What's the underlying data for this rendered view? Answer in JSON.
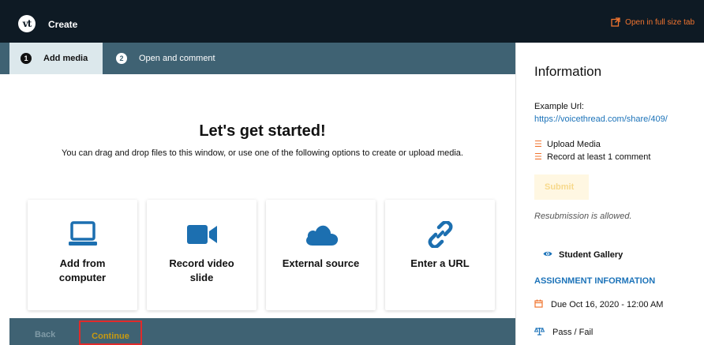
{
  "header": {
    "logo": "vt",
    "title": "Create",
    "open_full_label": "Open in full size tab"
  },
  "steps": [
    {
      "number": "1",
      "label": "Add media",
      "active": true
    },
    {
      "number": "2",
      "label": "Open and comment",
      "active": false
    }
  ],
  "main": {
    "heading": "Let's get started!",
    "subtext": "You can drag and drop files to this window, or use one of the following options to create or upload media.",
    "options": [
      {
        "icon": "laptop-icon",
        "label": "Add from computer"
      },
      {
        "icon": "video-camera-icon",
        "label": "Record video slide"
      },
      {
        "icon": "cloud-icon",
        "label": "External source"
      },
      {
        "icon": "link-icon",
        "label": "Enter a URL"
      }
    ]
  },
  "footer": {
    "back_label": "Back",
    "continue_label": "Continue"
  },
  "sidebar": {
    "title": "Information",
    "example_prefix": "Example Url: ",
    "example_url": "https://voicethread.com/share/409/",
    "requirements": [
      "Upload Media",
      "Record at least 1 comment"
    ],
    "submit_label": "Submit",
    "resubmission": "Resubmission is allowed.",
    "gallery_label": "Student Gallery",
    "assignment_heading": "ASSIGNMENT INFORMATION",
    "due": "Due Oct 16, 2020 - 12:00 AM",
    "grading": "Pass / Fail"
  },
  "colors": {
    "topbar": "#0e1a24",
    "steps_bar": "#3f6273",
    "accent_orange": "#f0742f",
    "card_icon_blue": "#1c6fb0",
    "link_blue": "#1c73b9",
    "highlight_red": "#e02a2a"
  }
}
